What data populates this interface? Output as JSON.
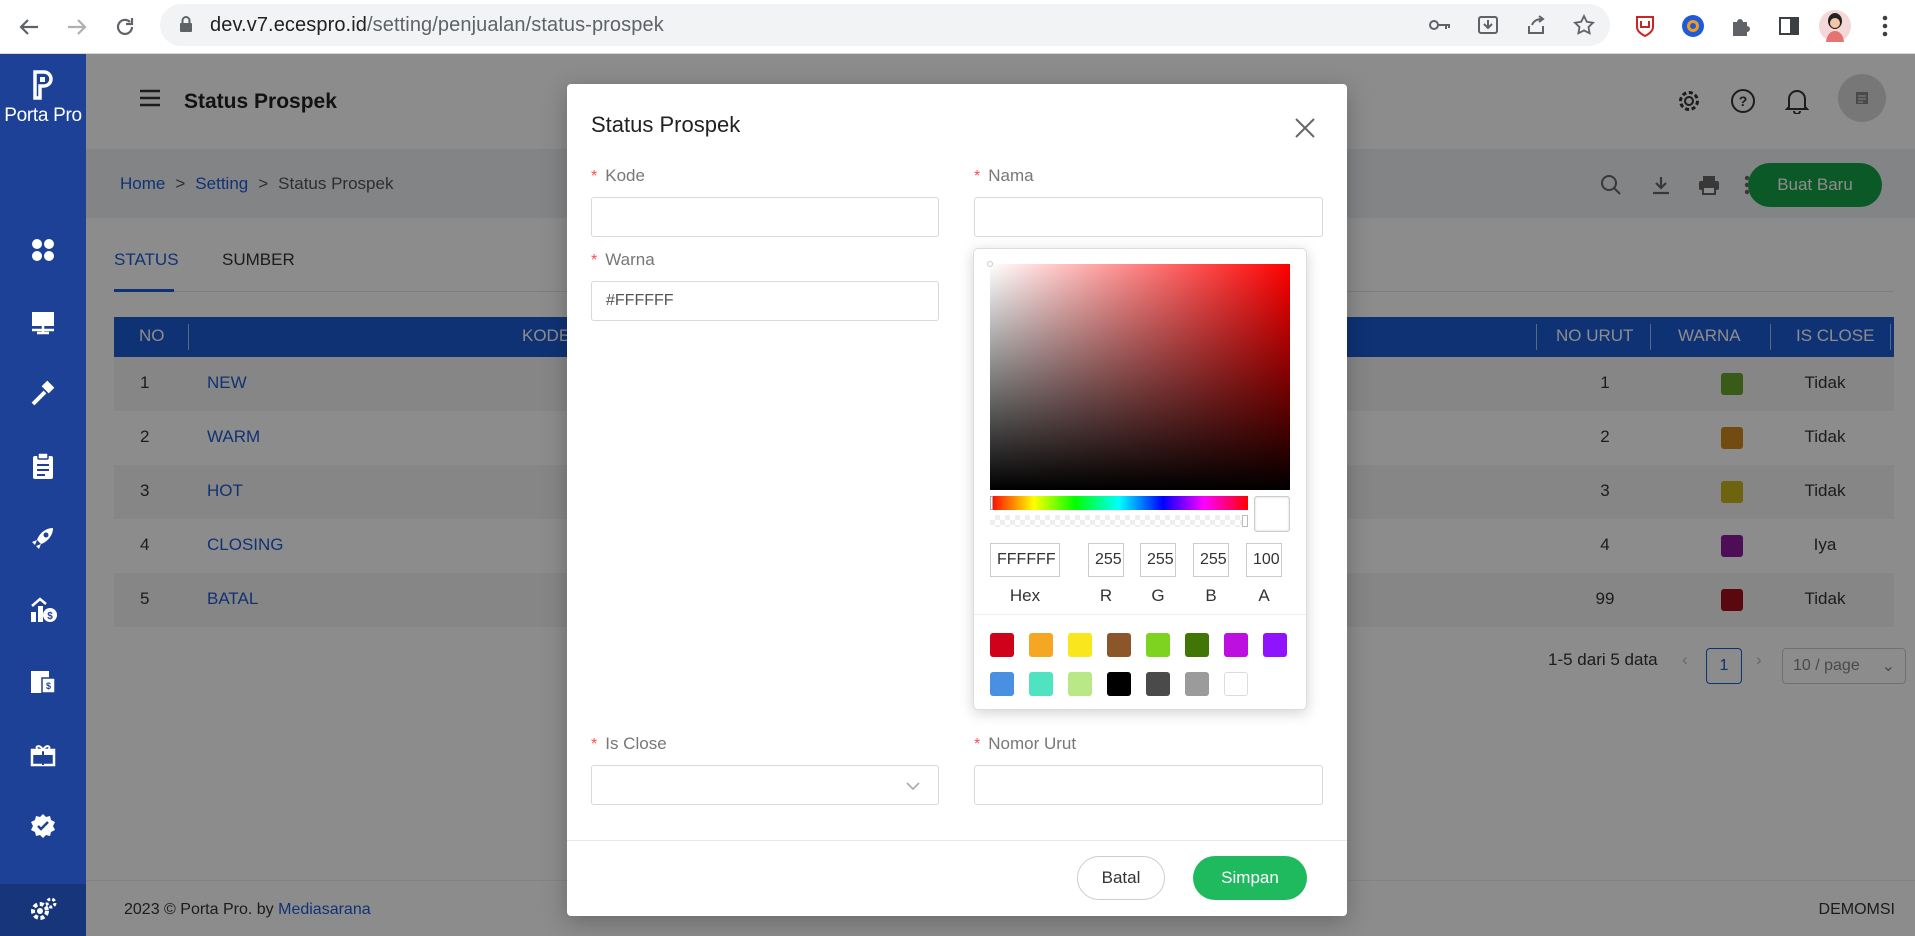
{
  "browser": {
    "url_host": "dev.v7.ecespro.id",
    "url_path": "/setting/penjualan/status-prospek"
  },
  "sidebar": {
    "brand": "Porta Pro",
    "items": [
      {
        "icon": "dashboard-icon"
      },
      {
        "icon": "presentation-icon"
      },
      {
        "icon": "hammer-icon"
      },
      {
        "icon": "clipboard-icon"
      },
      {
        "icon": "rocket-icon"
      },
      {
        "icon": "finance-icon"
      },
      {
        "icon": "invoice-icon"
      },
      {
        "icon": "gift-icon"
      },
      {
        "icon": "badge-check-icon"
      },
      {
        "icon": "chart-icon"
      },
      {
        "icon": "settings-icon"
      }
    ]
  },
  "topbar": {
    "title": "Status Prospek"
  },
  "breadcrumb": {
    "home": "Home",
    "sep": ">",
    "setting": "Setting",
    "current": "Status Prospek"
  },
  "actions": {
    "new_button": "Buat Baru"
  },
  "tabs": [
    "STATUS",
    "SUMBER"
  ],
  "table": {
    "headers": {
      "no": "NO",
      "kode": "KODE",
      "no_urut": "NO URUT",
      "warna": "WARNA",
      "is_close": "IS CLOSE"
    },
    "rows": [
      {
        "no": "1",
        "kode": "NEW",
        "no_urut": "1",
        "warna": "#6aa52a",
        "is_close": "Tidak"
      },
      {
        "no": "2",
        "kode": "WARM",
        "no_urut": "2",
        "warna": "#d0891f",
        "is_close": "Tidak"
      },
      {
        "no": "3",
        "kode": "HOT",
        "no_urut": "3",
        "warna": "#c8b41a",
        "is_close": "Tidak"
      },
      {
        "no": "4",
        "kode": "CLOSING",
        "no_urut": "4",
        "warna": "#8e1a9c",
        "is_close": "Iya"
      },
      {
        "no": "5",
        "kode": "BATAL",
        "no_urut": "99",
        "warna": "#a3101c",
        "is_close": "Tidak"
      }
    ]
  },
  "pagination": {
    "summary": "1-5 dari 5 data",
    "page": "1",
    "page_size": "10 / page"
  },
  "footer": {
    "copyright": "2023 © Porta Pro. by",
    "company": "Mediasarana",
    "user": "DEMOMSI"
  },
  "modal": {
    "title": "Status Prospek",
    "fields": {
      "kode": {
        "label": "Kode",
        "value": ""
      },
      "nama": {
        "label": "Nama",
        "value": ""
      },
      "warna": {
        "label": "Warna",
        "value": "#FFFFFF"
      },
      "is_close": {
        "label": "Is Close",
        "value": ""
      },
      "nomor_urut": {
        "label": "Nomor Urut",
        "value": ""
      }
    },
    "required_mark": "*",
    "cancel": "Batal",
    "save": "Simpan"
  },
  "color_picker": {
    "hex": "FFFFFF",
    "r": "255",
    "g": "255",
    "b": "255",
    "a": "100",
    "labels": {
      "hex": "Hex",
      "r": "R",
      "g": "G",
      "b": "B",
      "a": "A"
    },
    "presets": [
      "#d0021b",
      "#f5a623",
      "#f8e71c",
      "#8b572a",
      "#7ed321",
      "#417505",
      "#bd10e0",
      "#9013fe",
      "#4a90e2",
      "#50e3c2",
      "#b8e986",
      "#000000",
      "#4a4a4a",
      "#9b9b9b",
      "#ffffff"
    ]
  }
}
